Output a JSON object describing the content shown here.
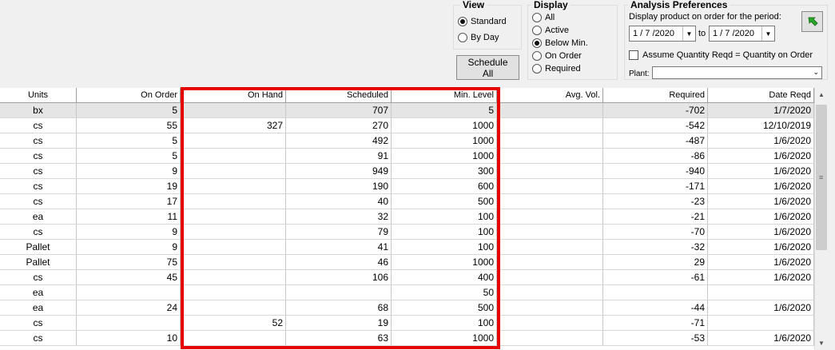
{
  "view": {
    "title": "View",
    "options": [
      {
        "label": "Standard",
        "selected": true
      },
      {
        "label": "By Day",
        "selected": false
      }
    ]
  },
  "schedule_all_label": "Schedule All",
  "display": {
    "title": "Display",
    "options": [
      {
        "label": "All",
        "selected": false
      },
      {
        "label": "Active",
        "selected": false
      },
      {
        "label": "Below Min.",
        "selected": true
      },
      {
        "label": "On Order",
        "selected": false
      },
      {
        "label": "Required",
        "selected": false
      }
    ]
  },
  "analysis": {
    "title": "Analysis Preferences",
    "period_label": "Display product on order for the period:",
    "from_date": "1 / 7 /2020",
    "to_label": "to",
    "to_date": "1 / 7 /2020",
    "assume_label": "Assume Quantity Reqd = Quantity on Order",
    "assume_checked": false,
    "plant_label": "Plant:",
    "plant_value": ""
  },
  "grid": {
    "columns": [
      "Units",
      "On Order",
      "On Hand",
      "Scheduled",
      "Min. Level",
      "Avg. Vol.",
      "Required",
      "Date Reqd"
    ],
    "rows": [
      [
        "bx",
        "5",
        "",
        "707",
        "5",
        "",
        "-702",
        "1/7/2020"
      ],
      [
        "cs",
        "55",
        "327",
        "270",
        "1000",
        "",
        "-542",
        "12/10/2019"
      ],
      [
        "cs",
        "5",
        "",
        "492",
        "1000",
        "",
        "-487",
        "1/6/2020"
      ],
      [
        "cs",
        "5",
        "",
        "91",
        "1000",
        "",
        "-86",
        "1/6/2020"
      ],
      [
        "cs",
        "9",
        "",
        "949",
        "300",
        "",
        "-940",
        "1/6/2020"
      ],
      [
        "cs",
        "19",
        "",
        "190",
        "600",
        "",
        "-171",
        "1/6/2020"
      ],
      [
        "cs",
        "17",
        "",
        "40",
        "500",
        "",
        "-23",
        "1/6/2020"
      ],
      [
        "ea",
        "11",
        "",
        "32",
        "100",
        "",
        "-21",
        "1/6/2020"
      ],
      [
        "cs",
        "9",
        "",
        "79",
        "100",
        "",
        "-70",
        "1/6/2020"
      ],
      [
        "Pallet",
        "9",
        "",
        "41",
        "100",
        "",
        "-32",
        "1/6/2020"
      ],
      [
        "Pallet",
        "75",
        "",
        "46",
        "1000",
        "",
        "29",
        "1/6/2020"
      ],
      [
        "cs",
        "45",
        "",
        "106",
        "400",
        "",
        "-61",
        "1/6/2020"
      ],
      [
        "ea",
        "",
        "",
        "",
        "50",
        "",
        "",
        ""
      ],
      [
        "ea",
        "24",
        "",
        "68",
        "500",
        "",
        "-44",
        "1/6/2020"
      ],
      [
        "cs",
        "",
        "52",
        "19",
        "100",
        "",
        "-71",
        ""
      ],
      [
        "cs",
        "10",
        "",
        "63",
        "1000",
        "",
        "-53",
        "1/6/2020"
      ]
    ]
  },
  "highlight_color": "#e60000"
}
